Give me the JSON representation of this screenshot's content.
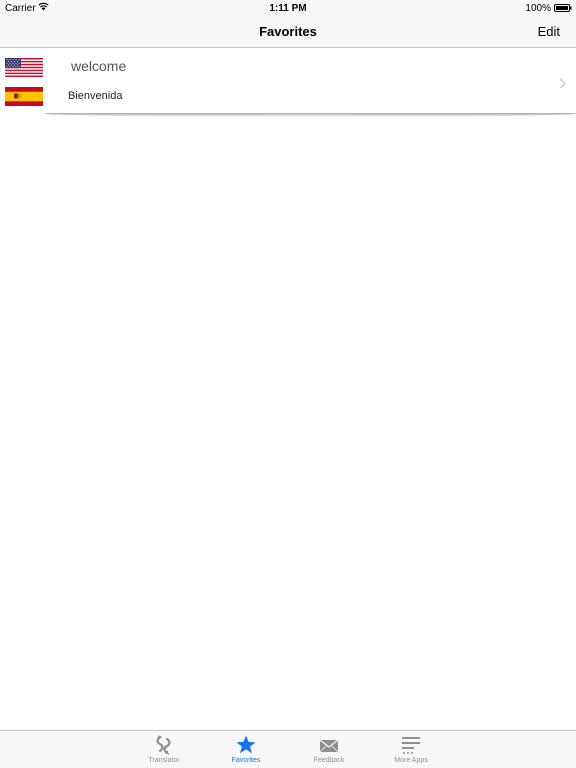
{
  "status_bar": {
    "carrier": "Carrier",
    "time": "1:11 PM",
    "battery": "100%",
    "wifi_icon": "wifi-icon",
    "battery_icon": "battery-icon"
  },
  "nav": {
    "title": "Favorites",
    "edit_label": "Edit"
  },
  "favorites": [
    {
      "source_text": "welcome",
      "target_text": "Bienvenida",
      "source_flag": "us-flag-icon",
      "target_flag": "spain-flag-icon"
    }
  ],
  "tab_bar": {
    "tabs": [
      {
        "label": "Translator",
        "icon": "translator-icon",
        "active": false
      },
      {
        "label": "Favorites",
        "icon": "star-icon",
        "active": true
      },
      {
        "label": "Feedback",
        "icon": "envelope-icon",
        "active": false
      },
      {
        "label": "More Apps",
        "icon": "list-icon",
        "active": false
      }
    ],
    "active_color": "#1a73e8",
    "inactive_color": "#929292"
  }
}
